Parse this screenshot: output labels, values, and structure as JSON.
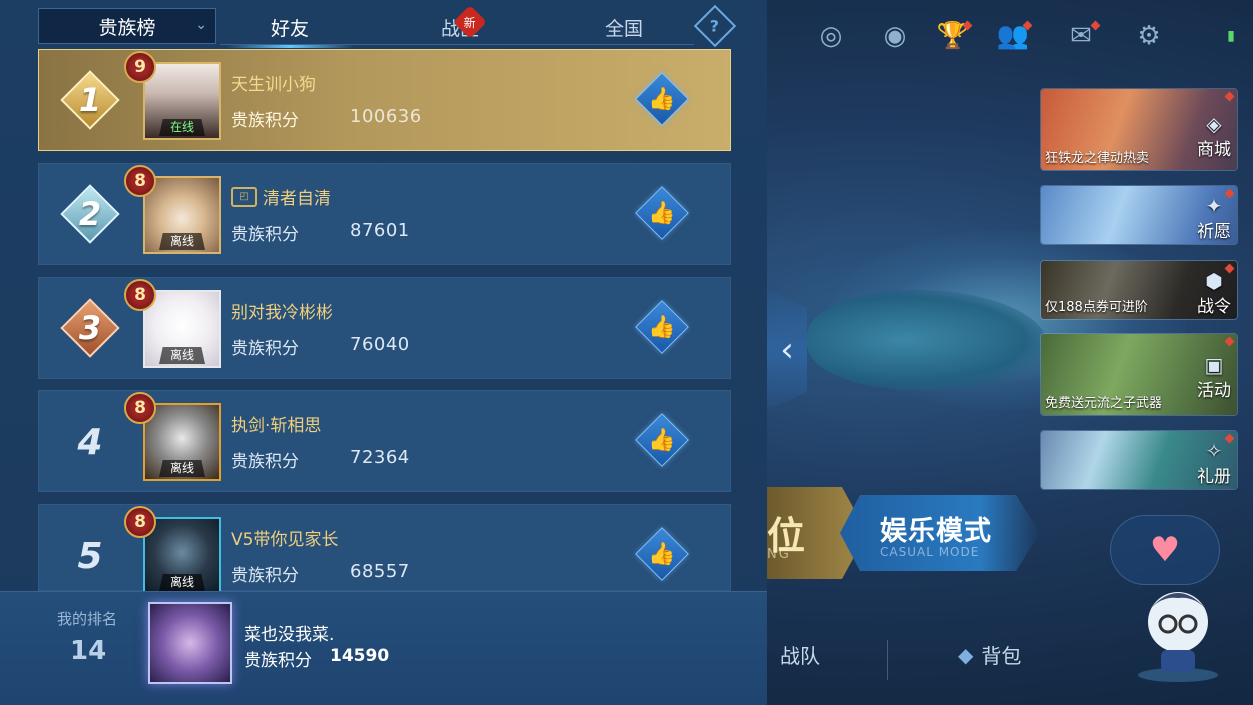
{
  "tabs": {
    "dropdown_label": "贵族榜",
    "items": [
      {
        "label": "好友",
        "active": true
      },
      {
        "label": "战区",
        "badge": "新"
      },
      {
        "label": "全国"
      }
    ],
    "help": "?"
  },
  "leaderboard": [
    {
      "rank": "1",
      "level": "9",
      "name": "天生训小狗",
      "status": "在线",
      "score_label": "贵族积分",
      "score": "100636"
    },
    {
      "rank": "2",
      "level": "8",
      "name": "清者自清",
      "status": "离线",
      "score_label": "贵族积分",
      "score": "87601"
    },
    {
      "rank": "3",
      "level": "8",
      "name": "别对我冷彬彬",
      "status": "离线",
      "score_label": "贵族积分",
      "score": "76040"
    },
    {
      "rank": "4",
      "level": "8",
      "name": "执剑·斩相思",
      "status": "离线",
      "score_label": "贵族积分",
      "score": "72364"
    },
    {
      "rank": "5",
      "level": "8",
      "name": "V5带你见家长",
      "status": "离线",
      "score_label": "贵族积分",
      "score": "68557"
    }
  ],
  "my_rank": {
    "label": "我的排名",
    "rank": "14",
    "name": "菜也没我菜.",
    "score_label": "贵族积分",
    "score": "14590"
  },
  "side_banners": [
    {
      "caption": "狂铁龙之律动热卖",
      "tag": "商城",
      "icon": "shop-icon"
    },
    {
      "caption": "",
      "tag": "祈愿",
      "icon": "wish-icon"
    },
    {
      "caption": "仅188点券可进阶",
      "tag": "战令",
      "icon": "battle-pass-icon"
    },
    {
      "caption": "免费送元流之子武器",
      "tag": "活动",
      "icon": "event-icon"
    },
    {
      "caption": "",
      "tag": "礼册",
      "icon": "gift-book-icon"
    }
  ],
  "modes": {
    "rank_big": "位",
    "rank_small": "NG",
    "casual_big": "娱乐模式",
    "casual_small": "CASUAL MODE"
  },
  "bottom_nav": {
    "team": "战队",
    "bag": "背包"
  },
  "colors": {
    "gold_row": "#b3985c",
    "row": "#27507a",
    "panel": "#1d3e63",
    "accent": "#5ec8ff",
    "name": "#f0cf7d"
  }
}
